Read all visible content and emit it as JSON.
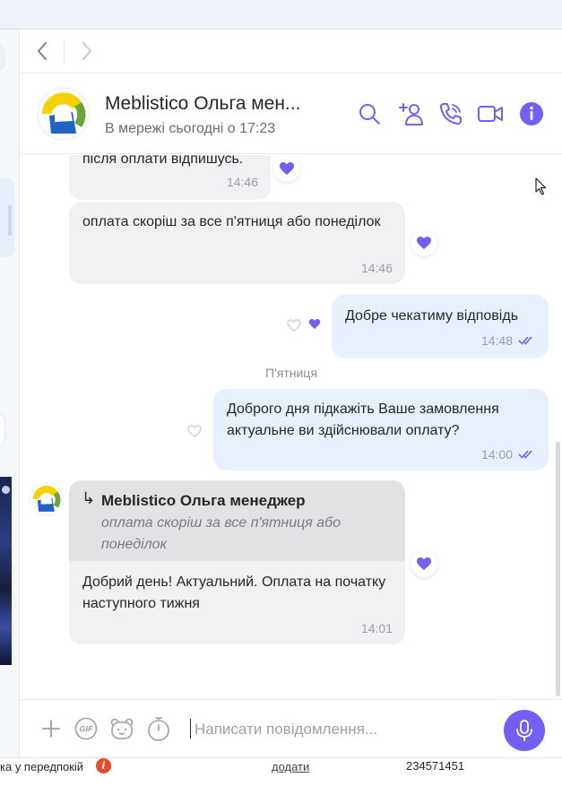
{
  "navigation": {
    "back_label": "Back",
    "forward_label": "Forward"
  },
  "header": {
    "name": "Meblistico Ольга мен...",
    "status": "В мережі сьогодні о 17:23"
  },
  "messages": [
    {
      "direction": "in",
      "text": "після оплати відпишусь.",
      "time": "14:46",
      "reaction": "heart-filled"
    },
    {
      "direction": "in",
      "text": "оплата скоріш за все п'ятниця або понеділок",
      "time": "14:46",
      "reaction": "heart-filled"
    },
    {
      "direction": "out",
      "text": "Добре чекатиму відповідь",
      "time": "14:48",
      "reaction": "heart-filled",
      "status": "read"
    },
    {
      "direction": "out",
      "text": "Доброго дня підкажіть Ваше замовлення актуальне ви здійснювали оплату?",
      "time": "14:00",
      "reaction": "heart-outline",
      "status": "read"
    },
    {
      "direction": "in",
      "reply_to": {
        "author": "Meblistico Ольга менеджер",
        "text": "оплата скоріш за все п'ятниця або понеділок"
      },
      "text": "Добрий день! Актуальний. Оплата на початку наступного тижня",
      "time": "14:01",
      "reaction": "heart-filled"
    }
  ],
  "day_separator": "П'ятниця",
  "composer": {
    "placeholder": "Написати повідомлення..."
  },
  "background": {
    "bottom_label": "ка у передпокій",
    "bottom_link": "додати",
    "bottom_number": "234571451"
  },
  "colors": {
    "accent": "#7360f2",
    "incoming_bubble": "#f1f1f3",
    "outgoing_bubble": "#e8effd"
  }
}
